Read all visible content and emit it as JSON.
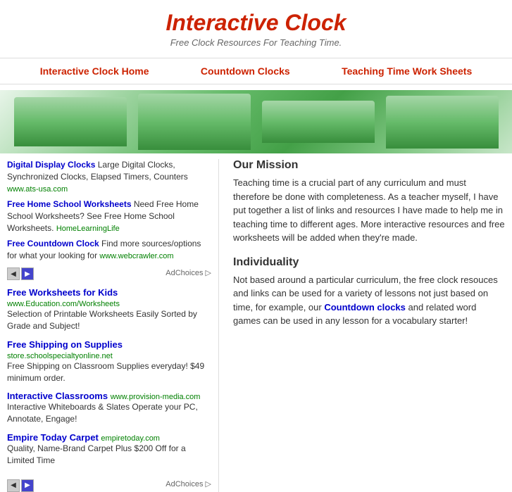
{
  "header": {
    "title": "Interactive Clock",
    "subtitle": "Free Clock Resources For Teaching Time."
  },
  "nav": {
    "items": [
      {
        "label": "Interactive Clock Home",
        "href": "#"
      },
      {
        "label": "Countdown Clocks",
        "href": "#"
      },
      {
        "label": "Teaching Time Work Sheets",
        "href": "#"
      }
    ]
  },
  "ad_links": [
    {
      "title": "Digital Display Clocks",
      "desc": " Large Digital Clocks, Synchronized Clocks, Elapsed Timers, Counters ",
      "url": "www.ats-usa.com"
    },
    {
      "title": "Free Home School Worksheets",
      "desc": " Need Free Home School Worksheets? See Free Home School Worksheets. ",
      "url": "HomeLearningLife"
    },
    {
      "title": "Free Countdown Clock",
      "desc": " Find more sources/options for what your looking for ",
      "url": "www.webcrawler.com"
    }
  ],
  "adchoices_label": "AdChoices ▷",
  "sidebar_items": [
    {
      "title": "Free Worksheets for Kids",
      "url": "www.Education.com/Worksheets",
      "desc": "Selection of Printable Worksheets Easily Sorted by Grade and Subject!"
    },
    {
      "title": "Free Shipping on Supplies",
      "url": "store.schoolspecialtyonline.net",
      "desc": "Free Shipping on Classroom Supplies everyday! $49 minimum order."
    },
    {
      "title": "Interactive Classrooms",
      "url": "www.provision-media.com",
      "desc": "Interactive Whiteboards & Slates Operate your PC, Annotate, Engage!"
    },
    {
      "title": "Empire Today Carpet",
      "url": "empiretoday.com",
      "desc": "Quality, Name-Brand Carpet Plus $200 Off for a Limited Time"
    }
  ],
  "mission": {
    "heading": "Our Mission",
    "text": "Teaching time is a crucial part of any curriculum and must therefore be done with completeness. As a teacher myself, I have put together a list of links and resources I have made to help me in teaching time to different ages. More interactive resources and free worksheets will be added when they're made."
  },
  "individuality": {
    "heading": "Individuality",
    "text_before": "Not based around a particular curriculum, the free clock resouces and links can be used for a variety of lessons not just based on time, for example, our ",
    "link_label": "Countdown clocks",
    "text_after": " and related word games can be used in any lesson for a vocabulary starter!"
  },
  "arrows": {
    "left": "◀",
    "right": "▶"
  }
}
